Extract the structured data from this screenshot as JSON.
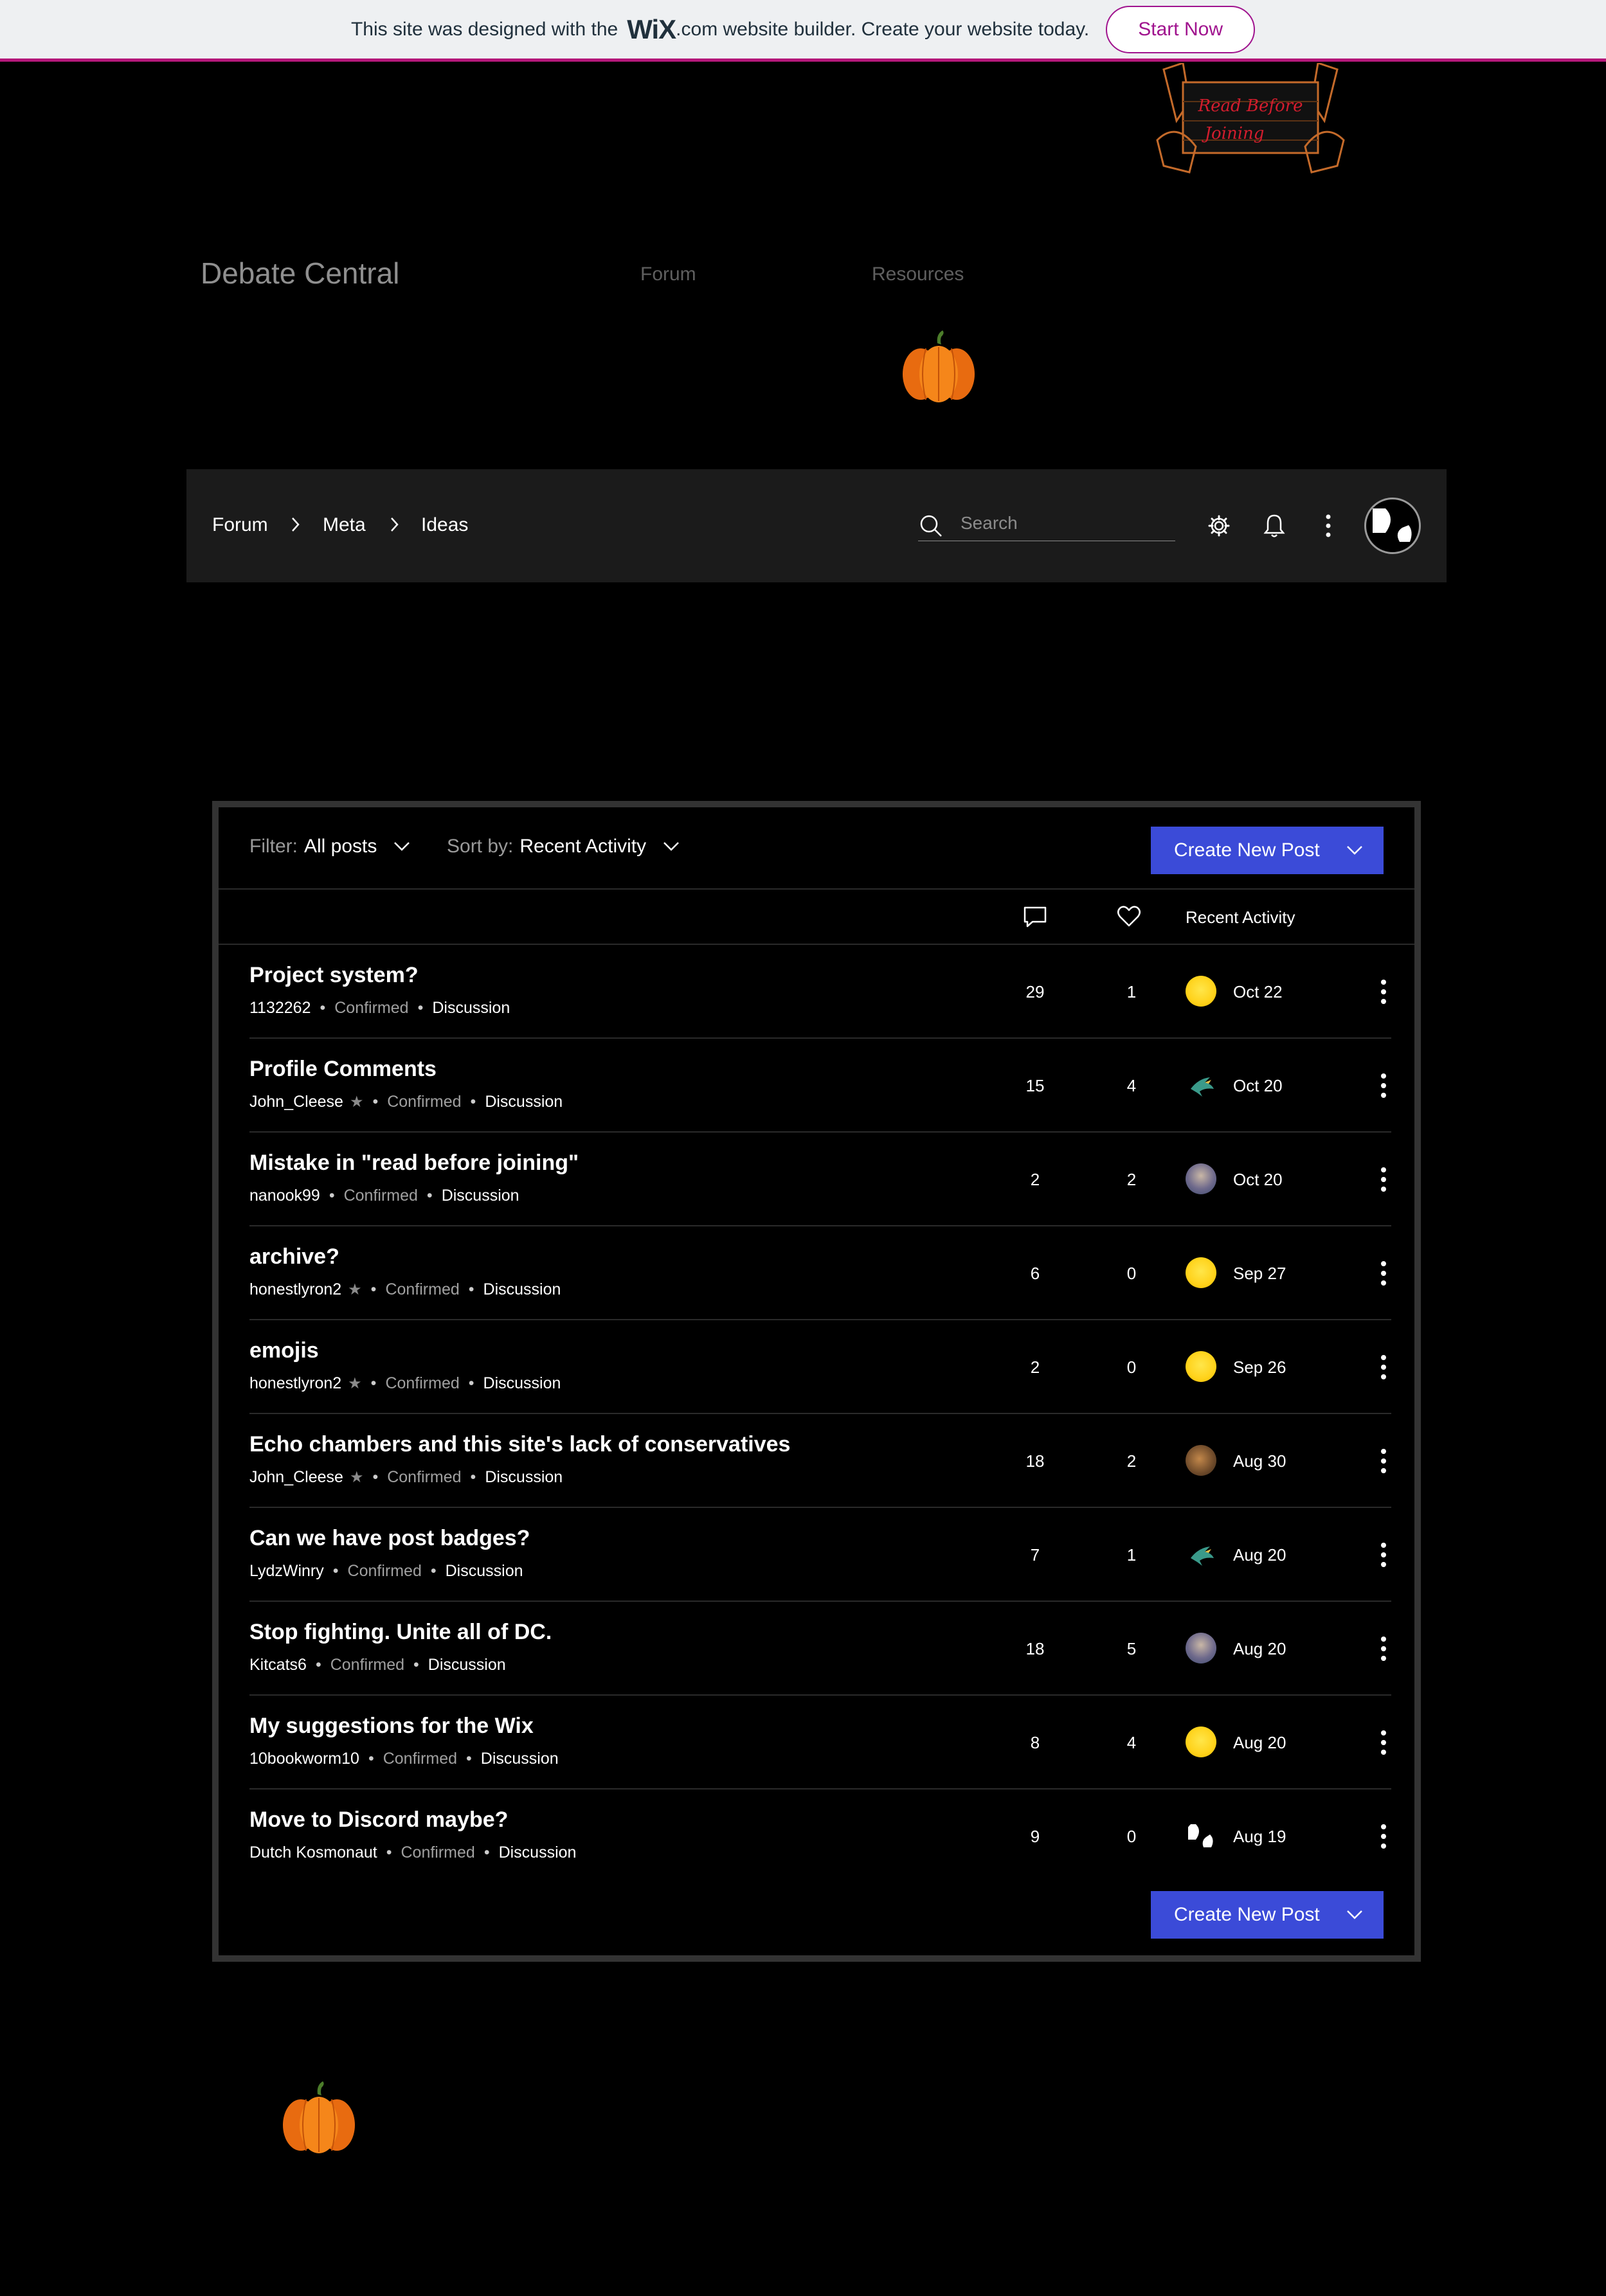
{
  "banner": {
    "text_before": "This site was designed with the",
    "logo": "WiX",
    "text_after": ".com website builder. Create your website today.",
    "cta": "Start Now"
  },
  "sign_text": [
    "Read Before",
    "Joining"
  ],
  "site": {
    "title": "Debate Central",
    "nav": [
      "Forum",
      "Resources"
    ]
  },
  "forum_bar": {
    "breadcrumb": [
      "Forum",
      "Meta",
      "Ideas"
    ],
    "search_placeholder": "Search",
    "icons": [
      "settings-icon",
      "bell-icon",
      "more-icon"
    ]
  },
  "toolbar": {
    "filter_label": "Filter:",
    "filter_value": "All posts",
    "sort_label": "Sort by:",
    "sort_value": "Recent Activity",
    "create_label": "Create New Post"
  },
  "columns": {
    "comments_icon": "comment-icon",
    "likes_icon": "heart-icon",
    "recent": "Recent Activity"
  },
  "posts": [
    {
      "title": "Project system?",
      "author": "1132262",
      "star": false,
      "status": "Confirmed",
      "category": "Discussion",
      "comments": "29",
      "likes": "1",
      "avatar": "yellow",
      "date": "Oct 22"
    },
    {
      "title": "Profile Comments",
      "author": "John_Cleese",
      "star": true,
      "status": "Confirmed",
      "category": "Discussion",
      "comments": "15",
      "likes": "4",
      "avatar": "bird",
      "date": "Oct 20"
    },
    {
      "title": "Mistake in \"read before joining\"",
      "author": "nanook99",
      "star": false,
      "status": "Confirmed",
      "category": "Discussion",
      "comments": "2",
      "likes": "2",
      "avatar": "photo",
      "date": "Oct 20"
    },
    {
      "title": "archive?",
      "author": "honestlyron2",
      "star": true,
      "status": "Confirmed",
      "category": "Discussion",
      "comments": "6",
      "likes": "0",
      "avatar": "yellow",
      "date": "Sep 27"
    },
    {
      "title": "emojis",
      "author": "honestlyron2",
      "star": true,
      "status": "Confirmed",
      "category": "Discussion",
      "comments": "2",
      "likes": "0",
      "avatar": "yellow",
      "date": "Sep 26"
    },
    {
      "title": "Echo chambers and this site's lack of conservatives",
      "author": "John_Cleese",
      "star": true,
      "status": "Confirmed",
      "category": "Discussion",
      "comments": "18",
      "likes": "2",
      "avatar": "brown",
      "date": "Aug 30"
    },
    {
      "title": "Can we have post badges?",
      "author": "LydzWinry",
      "star": false,
      "status": "Confirmed",
      "category": "Discussion",
      "comments": "7",
      "likes": "1",
      "avatar": "bird",
      "date": "Aug 20"
    },
    {
      "title": "Stop fighting. Unite all of DC.",
      "author": "Kitcats6",
      "star": false,
      "status": "Confirmed",
      "category": "Discussion",
      "comments": "18",
      "likes": "5",
      "avatar": "photo",
      "date": "Aug 20"
    },
    {
      "title": "My suggestions for the Wix",
      "author": "10bookworm10",
      "star": false,
      "status": "Confirmed",
      "category": "Discussion",
      "comments": "8",
      "likes": "4",
      "avatar": "yellow",
      "date": "Aug 20"
    },
    {
      "title": "Move to Discord maybe?",
      "author": "Dutch Kosmonaut",
      "star": false,
      "status": "Confirmed",
      "category": "Discussion",
      "comments": "9",
      "likes": "0",
      "avatar": "dc",
      "date": "Aug 19"
    }
  ],
  "colors": {
    "background": "#000000",
    "bar": "#1b1b1b",
    "accent_button": "#3b4bd8",
    "wix_brand": "#a0138e"
  }
}
